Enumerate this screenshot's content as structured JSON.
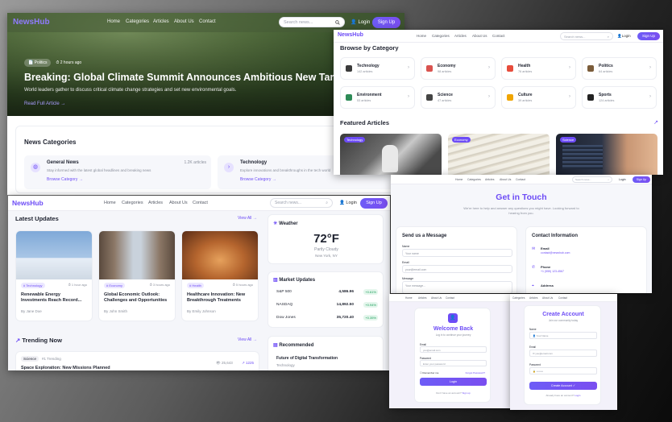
{
  "brand": "NewsHub",
  "nav": [
    "Home",
    "Categories",
    "Articles",
    "About Us",
    "Contact"
  ],
  "search_placeholder": "Search news...",
  "login": "Login",
  "signup": "Sign Up",
  "hero": {
    "tag": "Politics",
    "time": "2 hours ago",
    "title": "Breaking: Global Climate Summit Announces Ambitious New Targets",
    "subtitle": "World leaders gather to discuss critical climate change strategies and set new environmental goals.",
    "link": "Read Full Article"
  },
  "news_categories": {
    "title": "News Categories",
    "items": [
      {
        "name": "General News",
        "desc": "Stay informed with the latest global headlines and breaking news",
        "count": "1.2K articles",
        "link": "Browse Category"
      },
      {
        "name": "Technology",
        "desc": "Explore innovations and breakthroughs in the tech world",
        "link": "Browse Category"
      }
    ]
  },
  "browse": {
    "title": "Browse by Category",
    "items": [
      {
        "name": "Technology",
        "count": "142 articles",
        "color": "#3b3b3b"
      },
      {
        "name": "Economy",
        "count": "98 articles",
        "color": "#d9534f"
      },
      {
        "name": "Health",
        "count": "76 articles",
        "color": "#e74c3c"
      },
      {
        "name": "Politics",
        "count": "64 articles",
        "color": "#7b5c3a"
      },
      {
        "name": "Environment",
        "count": "53 articles",
        "color": "#2e8b57"
      },
      {
        "name": "Science",
        "count": "47 articles",
        "color": "#444444"
      },
      {
        "name": "Culture",
        "count": "39 articles",
        "color": "#f0a500"
      },
      {
        "name": "Sports",
        "count": "124 articles",
        "color": "#222222"
      }
    ]
  },
  "featured": {
    "title": "Featured Articles",
    "tags": [
      "Technology",
      "Economy",
      "Science"
    ]
  },
  "latest": {
    "title": "Latest Updates",
    "view_all": "View All",
    "articles": [
      {
        "tag": "Technology",
        "time": "1 hour ago",
        "title": "Renewable Energy Investments Reach Record...",
        "author": "By Jane Doe"
      },
      {
        "tag": "Economy",
        "time": "3 hours ago",
        "title": "Global Economic Outlook: Challenges and Opportunities",
        "author": "By John Smith"
      },
      {
        "tag": "Health",
        "time": "5 hours ago",
        "title": "Healthcare Innovation: New Breakthrough Treatments",
        "author": "By Emily Johnson"
      }
    ]
  },
  "trending": {
    "title": "Trending Now",
    "view_all": "View All",
    "tag": "Science",
    "rank": "#1 Trending",
    "views": "25,643",
    "shares": "1225",
    "headline": "Space Exploration: New Missions Planned"
  },
  "weather": {
    "title": "Weather",
    "temp": "72°F",
    "condition": "Partly Cloudy",
    "location": "New York, NY"
  },
  "market": {
    "title": "Market Updates",
    "rows": [
      {
        "name": "S&P 500",
        "value": "4,586.96",
        "change": "+0.61%"
      },
      {
        "name": "NASDAQ",
        "value": "14,892.50",
        "change": "+0.94%"
      },
      {
        "name": "Dow Jones",
        "value": "35,720.40",
        "change": "+0.35%"
      }
    ]
  },
  "recommended": {
    "title": "Recommended",
    "item": "Future of Digital Transformation",
    "cat": "Technology"
  },
  "contact": {
    "title": "Get in Touch",
    "subtitle": "We're here to help and answer any questions you might have. Looking forward to hearing from you.",
    "send_title": "Send us a Message",
    "name_label": "Name",
    "name_ph": "Your name",
    "email_label": "Email",
    "email_ph": "your@email.com",
    "message_label": "Message",
    "message_ph": "Your message...",
    "info_title": "Contact Information",
    "email_title": "Email",
    "email_val": "contact@newshub.com",
    "phone_title": "Phone",
    "phone_val": "+1 (555) 123-4567",
    "address_title": "Address"
  },
  "loginform": {
    "title": "Welcome Back",
    "subtitle": "Log in to continue your journey",
    "email_label": "Email",
    "email_ph": "you@email.com",
    "password_label": "Password",
    "password_ph": "Enter your password",
    "remember": "Remember me",
    "forgot": "Forgot Password?",
    "button": "Login",
    "footer": "Don't have an account?",
    "footer_link": "Sign up"
  },
  "signupform": {
    "title": "Create Account",
    "subtitle": "Join our community today",
    "name_label": "Name",
    "name_ph": "Your Name",
    "email_label": "Email",
    "email_ph": "you@email.com",
    "password_label": "Password",
    "password_ph": "••••••••",
    "button": "Create Account ✓",
    "footer": "Already have an account?",
    "footer_link": "Login"
  },
  "colors": {
    "accent": "#6d4cf6",
    "positive": "#1a9e5a"
  }
}
